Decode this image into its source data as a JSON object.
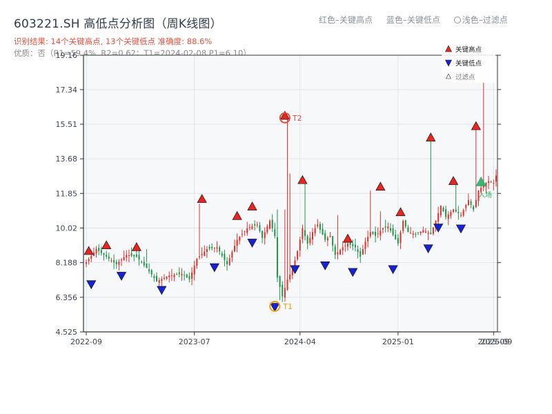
{
  "header": {
    "title": "603221.SH 高低点分析图（周K线图）",
    "legend_red": "红色–关键高点",
    "legend_blue": "蓝色–关键低点",
    "legend_gray": "浅色–过滤点",
    "result_line": "识别结果: 14个关键高点, 13个关键低点   准确度: 88.6%",
    "quality_line": "优质：否（R1=59.4%, R2=0.62；T1=2024-02-08 P1=6.10）"
  },
  "legend_box": {
    "high": "关键高点",
    "low": "关键低点",
    "filtered": "过滤点"
  },
  "annotations": {
    "t1": "T1",
    "t2": "T2",
    "entry": "入场"
  },
  "colors": {
    "up": "#e02f2a",
    "down": "#1d9448",
    "high_marker": "#e8261e",
    "low_marker": "#1622d8",
    "t1_ring": "#f39c12",
    "t2_ring": "#e74c3c",
    "entry_marker": "#27ae60",
    "plot_bg": "#f6f8fa"
  },
  "chart_data": {
    "type": "candlestick",
    "title": "603221.SH 高低点分析图（周K线图）",
    "ylim": [
      4.525,
      19.16
    ],
    "y_ticks": [
      "4.525",
      "6.356",
      "8.188",
      "10.02",
      "11.85",
      "13.68",
      "15.51",
      "17.34",
      "19.16"
    ],
    "y_tick_values": [
      4.525,
      6.356,
      8.188,
      10.02,
      11.85,
      13.68,
      15.51,
      17.34,
      19.16
    ],
    "x_ticks": [
      "2022-09",
      "2023-07",
      "2024-04",
      "2025-01",
      "2025-09"
    ],
    "x_tick_index": [
      0,
      43,
      85,
      124,
      162
    ],
    "x_end_label": "2025-09",
    "close_path": [
      [
        0,
        8.2
      ],
      [
        4,
        8.9
      ],
      [
        8,
        8.5
      ],
      [
        12,
        8.1
      ],
      [
        16,
        8.6
      ],
      [
        20,
        8.5
      ],
      [
        24,
        7.9
      ],
      [
        28,
        7.2
      ],
      [
        33,
        7.5
      ],
      [
        38,
        7.6
      ],
      [
        41,
        7.3
      ],
      [
        44,
        8.4
      ],
      [
        48,
        8.9
      ],
      [
        52,
        9.0
      ],
      [
        56,
        8.1
      ],
      [
        60,
        9.4
      ],
      [
        64,
        10.0
      ],
      [
        68,
        10.2
      ],
      [
        70,
        9.5
      ],
      [
        73,
        10.4
      ],
      [
        75,
        9.6
      ],
      [
        76,
        7.4
      ],
      [
        78,
        6.4
      ],
      [
        80,
        7.3
      ],
      [
        82,
        7.8
      ],
      [
        84,
        8.8
      ],
      [
        86,
        10.0
      ],
      [
        88,
        9.2
      ],
      [
        90,
        9.8
      ],
      [
        92,
        10.2
      ],
      [
        95,
        9.4
      ],
      [
        97,
        9.6
      ],
      [
        99,
        8.6
      ],
      [
        102,
        9.0
      ],
      [
        104,
        9.2
      ],
      [
        107,
        9.0
      ],
      [
        109,
        8.5
      ],
      [
        111,
        9.3
      ],
      [
        113,
        9.8
      ],
      [
        115,
        9.6
      ],
      [
        118,
        10.0
      ],
      [
        120,
        10.1
      ],
      [
        124,
        9.2
      ],
      [
        126,
        10.4
      ],
      [
        128,
        9.8
      ],
      [
        131,
        9.7
      ],
      [
        134,
        9.9
      ],
      [
        137,
        9.7
      ],
      [
        139,
        10.4
      ],
      [
        141,
        11.2
      ],
      [
        143,
        10.6
      ],
      [
        146,
        11.0
      ],
      [
        149,
        10.7
      ],
      [
        152,
        11.5
      ],
      [
        154,
        11.0
      ],
      [
        156,
        12.0
      ],
      [
        158,
        12.3
      ],
      [
        160,
        12.5
      ],
      [
        162,
        12.4
      ],
      [
        163,
        12.8
      ]
    ],
    "wick_overrides": [
      [
        24,
        0.0,
        8.9
      ],
      [
        45,
        11.3,
        0.0
      ],
      [
        76,
        11.0,
        0.0
      ],
      [
        77,
        0.0,
        6.2
      ],
      [
        78,
        0.0,
        6.1
      ],
      [
        79,
        11.0,
        0.0
      ],
      [
        80,
        15.8,
        0.0
      ],
      [
        81,
        12.9,
        0.0
      ],
      [
        87,
        12.4,
        0.0
      ],
      [
        100,
        10.7,
        0.0
      ],
      [
        113,
        12.0,
        0.0
      ],
      [
        117,
        10.9,
        0.0
      ],
      [
        137,
        14.6,
        0.0
      ],
      [
        147,
        12.3,
        0.0
      ],
      [
        155,
        15.2,
        0.0
      ],
      [
        158,
        17.7,
        0.0
      ]
    ],
    "key_highs": [
      {
        "i": 1,
        "v": 8.55
      },
      {
        "i": 8,
        "v": 8.85
      },
      {
        "i": 20,
        "v": 8.75
      },
      {
        "i": 46,
        "v": 11.3
      },
      {
        "i": 60,
        "v": 10.4
      },
      {
        "i": 66,
        "v": 10.9
      },
      {
        "i": 79,
        "v": 15.7
      },
      {
        "i": 86,
        "v": 12.3
      },
      {
        "i": 104,
        "v": 9.2
      },
      {
        "i": 117,
        "v": 11.95
      },
      {
        "i": 125,
        "v": 10.6
      },
      {
        "i": 137,
        "v": 14.55
      },
      {
        "i": 146,
        "v": 12.25
      },
      {
        "i": 155,
        "v": 15.15
      }
    ],
    "key_lows": [
      {
        "i": 2,
        "v": 7.3
      },
      {
        "i": 14,
        "v": 7.75
      },
      {
        "i": 30,
        "v": 7.0
      },
      {
        "i": 51,
        "v": 8.2
      },
      {
        "i": 66,
        "v": 9.5
      },
      {
        "i": 75,
        "v": 6.1
      },
      {
        "i": 83,
        "v": 8.1
      },
      {
        "i": 95,
        "v": 8.3
      },
      {
        "i": 106,
        "v": 7.95
      },
      {
        "i": 122,
        "v": 8.1
      },
      {
        "i": 136,
        "v": 9.2
      },
      {
        "i": 140,
        "v": 10.3
      },
      {
        "i": 149,
        "v": 10.25
      }
    ],
    "t1": {
      "i": 75,
      "v": 6.1,
      "date": "2024-02-08"
    },
    "t2": {
      "i": 79,
      "v": 15.7
    },
    "entry": {
      "i": 157,
      "v": 12.45
    }
  }
}
